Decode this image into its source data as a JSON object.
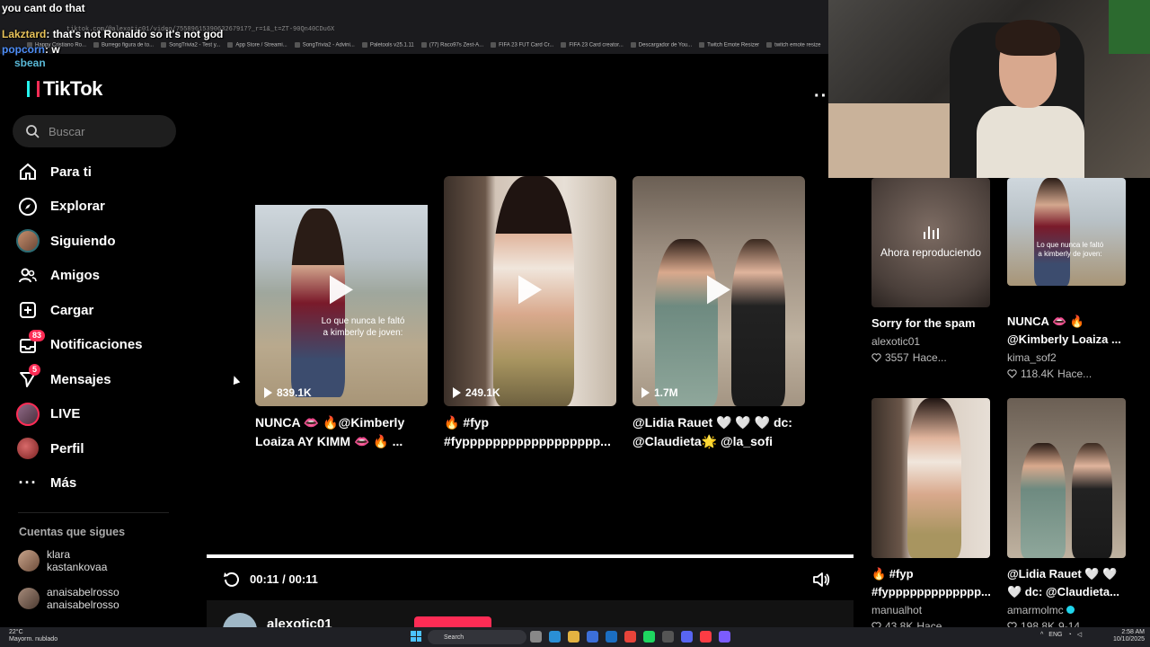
{
  "browser": {
    "url": "tiktok.com/@alexotic01/video/7558961539063267917?_r=1&_t=ZT-90Qn40CDu6X",
    "bookmarks": [
      "Happy Cristiano Ro...",
      "Burrego figura de to...",
      "SongTrivia2 - Test y...",
      "App Store / Streami...",
      "SongTrivia2 - Advini...",
      "Paletools v25.1.11",
      "(77) Raco97s Zest-A...",
      "FIFA 23 FUT Card Cr...",
      "FIFA 23 Card creator...",
      "Descargador de You...",
      "Twitch Emote Resizer",
      "twitch emote resize"
    ]
  },
  "chat": [
    {
      "user": "",
      "text": "you cant do that"
    },
    {
      "user": "Lakztard",
      "text": ": that's not Ronaldo so it's not god"
    },
    {
      "user": "popcorn",
      "text": ": w"
    },
    {
      "user": "sbean",
      "text": ""
    }
  ],
  "sidebar": {
    "logo": "TikTok",
    "search_placeholder": "Buscar",
    "items": [
      {
        "label": "Para ti",
        "icon": "home-icon"
      },
      {
        "label": "Explorar",
        "icon": "compass-icon"
      },
      {
        "label": "Siguiendo",
        "icon": "following-avatar-icon"
      },
      {
        "label": "Amigos",
        "icon": "friends-icon"
      },
      {
        "label": "Cargar",
        "icon": "upload-icon"
      },
      {
        "label": "Notificaciones",
        "icon": "inbox-icon",
        "badge": "83"
      },
      {
        "label": "Mensajes",
        "icon": "send-icon",
        "badge": "5"
      },
      {
        "label": "LIVE",
        "icon": "live-avatar-icon"
      },
      {
        "label": "Perfil",
        "icon": "profile-avatar-icon"
      },
      {
        "label": "Más",
        "icon": "more-icon"
      }
    ],
    "following_title": "Cuentas que sigues",
    "following": [
      {
        "line1": "klara",
        "line2": "kastankovaa"
      },
      {
        "line1": "anaisabelrosso",
        "line2": "anaisabelrosso"
      }
    ]
  },
  "grid": [
    {
      "views": "839.1K",
      "caption": "NUNCA 👄 🔥@Kimberly Loaiza AY KIMM 👄 🔥 ...",
      "overlay": "Lo que nunca le faltó a kimberly de joven:"
    },
    {
      "views": "249.1K",
      "caption": "🔥 #fyp #fypppppppppppppppppp..."
    },
    {
      "views": "1.7M",
      "caption": "@Lidia Rauet 🤍 🤍 🤍 dc: @Claudieta🌟 @la_sofi"
    }
  ],
  "player": {
    "time": "00:11 / 00:11",
    "progress": 1.0,
    "author": "alexotic01"
  },
  "right": [
    {
      "now_playing": "Ahora reproduciendo",
      "title": "Sorry for the spam",
      "author": "alexotic01",
      "likes": "3557",
      "time": "Hace..."
    },
    {
      "overlay": "Lo que nunca le faltó a kimberly de joven:",
      "title1": "NUNCA 👄 🔥",
      "title2": "@Kimberly Loaiza ...",
      "author": "kima_sof2",
      "likes": "118.4K",
      "time": "Hace..."
    },
    {
      "title1": "🔥 #fyp",
      "title2": "#fyppppppppppppp...",
      "author": "manualhot",
      "likes": "43.8K",
      "time": "Hace..."
    },
    {
      "title1": "@Lidia Rauet 🤍 🤍",
      "title2": "🤍 dc: @Claudieta...",
      "author": "amarmolmc",
      "likes": "198.8K",
      "time": "9-14"
    }
  ],
  "taskbar": {
    "weather_temp": "22°C",
    "weather_desc": "Mayorm. nublado",
    "search": "Search",
    "lang": "ENG",
    "clock_time": "2:58 AM",
    "clock_date": "10/10/2025"
  }
}
